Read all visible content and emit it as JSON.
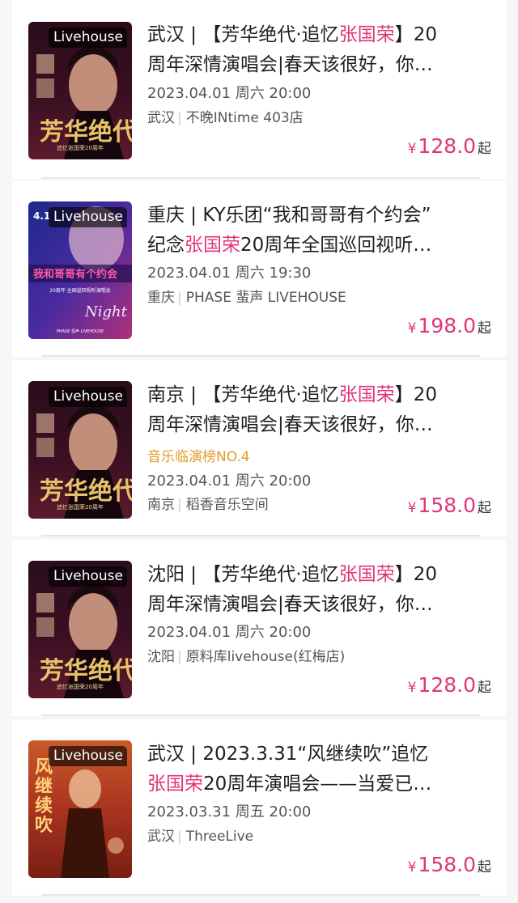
{
  "colors": {
    "highlight": "#e0357a",
    "tag": "#e39b2c",
    "text": "#1f1f1f",
    "meta": "#555555"
  },
  "events": [
    {
      "badge": "Livehouse",
      "title_line1": {
        "before": "武汉 | 【芳华绝代·追忆",
        "highlight": "张国荣",
        "after": "】20"
      },
      "title_line2": {
        "before": "周年深情演唱会|春天该很好，你…",
        "highlight": "",
        "after": ""
      },
      "tag": "",
      "date": "2023.04.01 周六 20:00",
      "city": "武汉",
      "venue": "不晚INtime 403店",
      "currency": "¥",
      "price": "128.0",
      "price_suffix": "起",
      "poster_icon": "poster-fanghua-icon"
    },
    {
      "badge": "Livehouse",
      "title_line1": {
        "before": "重庆 | KY乐团“我和哥哥有个约会”",
        "highlight": "",
        "after": ""
      },
      "title_line2": {
        "before": "纪念",
        "highlight": "张国荣",
        "after": "20周年全国巡回视听…"
      },
      "tag": "",
      "date": "2023.04.01 周六 19:30",
      "city": "重庆",
      "venue": "PHASE 蜚声 LIVEHOUSE",
      "currency": "¥",
      "price": "198.0",
      "price_suffix": "起",
      "poster_icon": "poster-night-icon"
    },
    {
      "badge": "Livehouse",
      "title_line1": {
        "before": "南京 | 【芳华绝代·追忆",
        "highlight": "张国荣",
        "after": "】20"
      },
      "title_line2": {
        "before": "周年深情演唱会|春天该很好，你…",
        "highlight": "",
        "after": ""
      },
      "tag": "音乐临演榜NO.4",
      "date": "2023.04.01 周六 20:00",
      "city": "南京",
      "venue": "稻香音乐空间",
      "currency": "¥",
      "price": "158.0",
      "price_suffix": "起",
      "poster_icon": "poster-fanghua-icon"
    },
    {
      "badge": "Livehouse",
      "title_line1": {
        "before": "沈阳 | 【芳华绝代·追忆",
        "highlight": "张国荣",
        "after": "】20"
      },
      "title_line2": {
        "before": "周年深情演唱会|春天该很好，你…",
        "highlight": "",
        "after": ""
      },
      "tag": "",
      "date": "2023.04.01 周六 20:00",
      "city": "沈阳",
      "venue": "原料库livehouse(红梅店)",
      "currency": "¥",
      "price": "128.0",
      "price_suffix": "起",
      "poster_icon": "poster-fanghua-icon"
    },
    {
      "badge": "Livehouse",
      "title_line1": {
        "before": "武汉 | 2023.3.31“风继续吹”追忆",
        "highlight": "",
        "after": ""
      },
      "title_line2": {
        "before": "",
        "highlight": "张国荣",
        "after": "20周年演唱会——当爱已…"
      },
      "tag": "",
      "date": "2023.03.31 周五 20:00",
      "city": "武汉",
      "venue": "ThreeLive",
      "currency": "¥",
      "price": "158.0",
      "price_suffix": "起",
      "poster_icon": "poster-wind-icon"
    }
  ]
}
